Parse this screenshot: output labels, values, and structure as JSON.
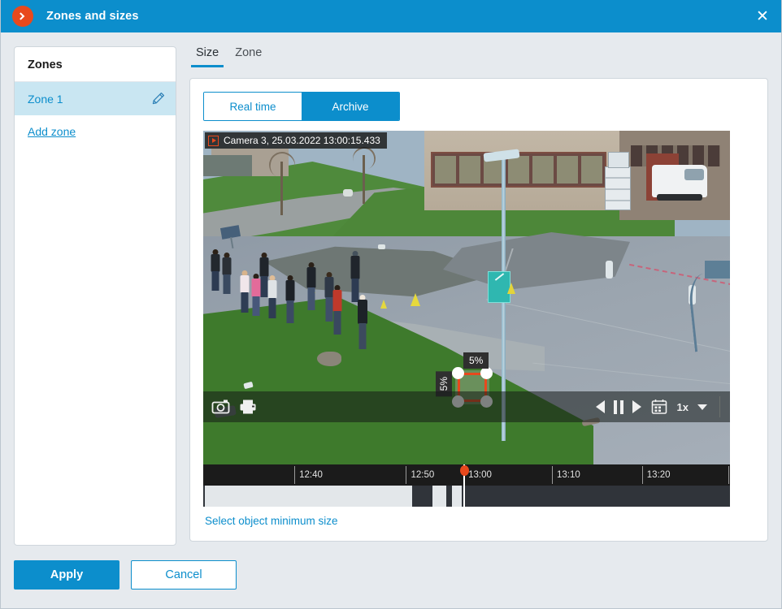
{
  "window": {
    "title": "Zones and sizes",
    "app_icon": "chevron-right-circle-icon",
    "close_label": "✕",
    "accent_color": "#0c8ecc",
    "brand_color": "#e8491d"
  },
  "sidebar": {
    "header": "Zones",
    "zones": [
      {
        "label": "Zone 1",
        "selected": true,
        "edit_icon": "pencil-icon"
      }
    ],
    "add_zone_label": "Add zone"
  },
  "tabs": [
    {
      "label": "Size",
      "active": true
    },
    {
      "label": "Zone",
      "active": false
    }
  ],
  "source_toggle": {
    "options": [
      {
        "label": "Real time",
        "active": false
      },
      {
        "label": "Archive",
        "active": true
      }
    ]
  },
  "video": {
    "overlay_label": "Camera 3, 25.03.2022 13:00:15.433",
    "camera_name": "Camera 3",
    "date": "25.03.2022",
    "time": "13:00:15.433",
    "rec_icon": "play-record-icon"
  },
  "size_selector": {
    "width_label": "5%",
    "height_label": "5%",
    "handles": [
      "top-left",
      "top-right",
      "bottom-left",
      "bottom-right"
    ]
  },
  "player_controls": {
    "snapshot_icon": "camera-icon",
    "print_icon": "printer-icon",
    "step_back_icon": "step-back-icon",
    "pause_icon": "pause-icon",
    "play_icon": "play-icon",
    "calendar_icon": "calendar-icon",
    "speed_value": "1x",
    "speed_chevron_icon": "chevron-down-icon"
  },
  "timeline": {
    "ticks": [
      {
        "label": "12:40",
        "pos_pct": 17.3
      },
      {
        "label": "12:50",
        "pos_pct": 38.5
      },
      {
        "label": "13:00",
        "pos_pct": 49.4
      },
      {
        "label": "13:10",
        "pos_pct": 66.2
      },
      {
        "label": "13:20",
        "pos_pct": 83.3
      }
    ],
    "playhead_pct": 49.4,
    "segments": [
      {
        "start_pct": 0.3,
        "width_pct": 39.4
      },
      {
        "start_pct": 43.5,
        "width_pct": 2.6
      },
      {
        "start_pct": 47.2,
        "width_pct": 1.9
      }
    ]
  },
  "links": {
    "select_min_size": "Select object minimum size"
  },
  "footer": {
    "apply_label": "Apply",
    "cancel_label": "Cancel"
  }
}
